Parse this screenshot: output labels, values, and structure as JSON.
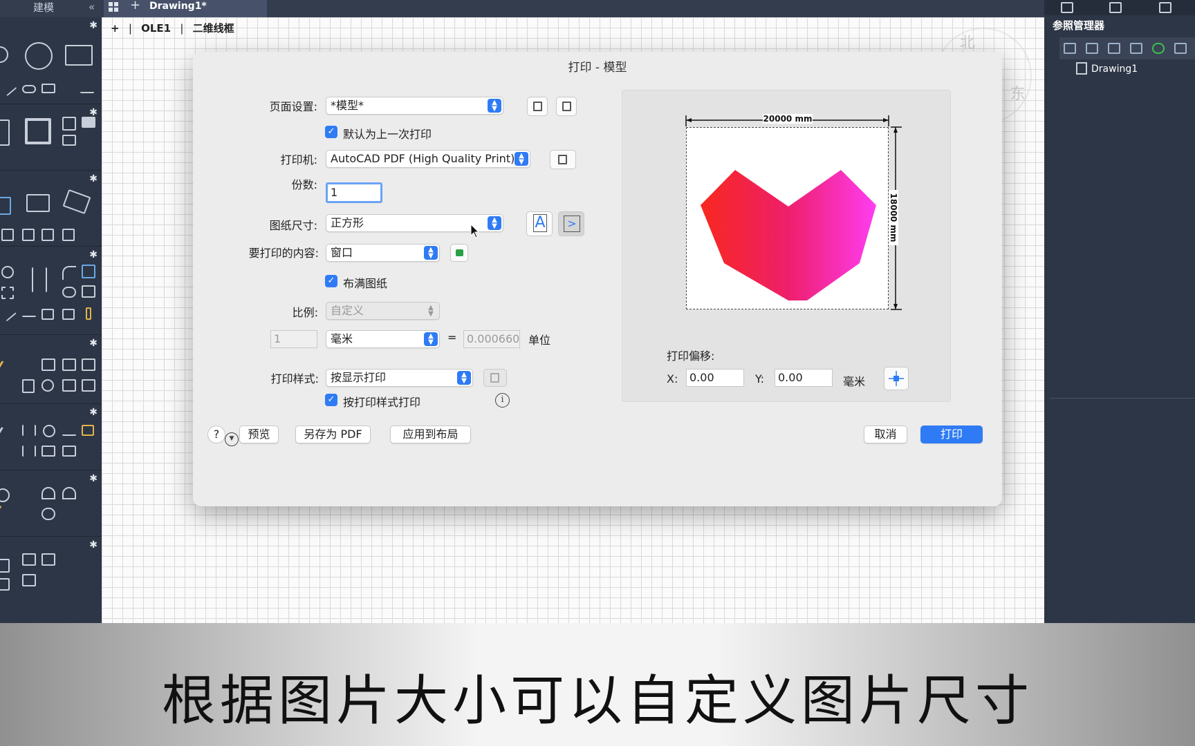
{
  "top": {
    "workspace_tab": "建模",
    "document_tab": "Drawing1*"
  },
  "viewport": {
    "items": [
      "+",
      "OLE1",
      "二维线框"
    ]
  },
  "compass": {
    "north": "北",
    "east": "东"
  },
  "right_panel": {
    "title": "参照管理器",
    "tree_item": "Drawing1"
  },
  "dialog": {
    "title": "打印 - 模型",
    "page_setup": {
      "label": "页面设置:",
      "value": "*模型*"
    },
    "default_last": {
      "label": "默认为上一次打印",
      "checked": true
    },
    "printer": {
      "label": "打印机:",
      "value": "AutoCAD PDF (High Quality Print)...."
    },
    "copies": {
      "label": "份数:",
      "value": "1"
    },
    "paper_size": {
      "label": "图纸尺寸:",
      "value": "正方形"
    },
    "what_to_print": {
      "label": "要打印的内容:",
      "value": "窗口"
    },
    "fit_to_paper": {
      "label": "布满图纸",
      "checked": true
    },
    "scale": {
      "label": "比例:",
      "value": "自定义",
      "left_value": "1",
      "unit": "毫米",
      "equals": "=",
      "right_value": "0.000660",
      "unit_label": "单位"
    },
    "plot_style": {
      "label": "打印样式:",
      "value": "按显示打印"
    },
    "print_with_styles": {
      "label": "按打印样式打印",
      "checked": true
    },
    "preview": {
      "width_label": "20000 mm",
      "height_label": "18000 mm"
    },
    "offset": {
      "label": "打印偏移:",
      "x_label": "X:",
      "x_value": "0.00",
      "y_label": "Y:",
      "y_value": "0.00",
      "unit": "毫米"
    },
    "buttons": {
      "help": "?",
      "preview": "预览",
      "save_pdf": "另存为 PDF",
      "apply_layout": "应用到布局",
      "cancel": "取消",
      "print": "打印"
    },
    "colors": {
      "accent": "#2f7bf5",
      "heart_left": "#f8281f",
      "heart_right": "#ff3df2"
    }
  },
  "caption": "根据图片大小可以自定义图片尺寸"
}
